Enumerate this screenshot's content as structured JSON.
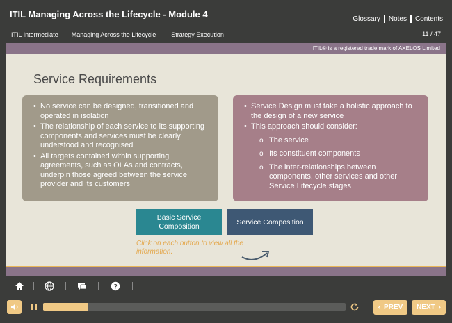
{
  "header": {
    "course_title": "ITIL Managing Across the Lifecycle - Module 4",
    "links": [
      "Glossary",
      "Notes",
      "Contents"
    ],
    "breadcrumb": [
      "ITIL Intermediate",
      "Managing Across the Lifecycle",
      "Strategy Execution"
    ],
    "page_count": "11 / 47"
  },
  "slide": {
    "trademark": "ITIL® is a registered trade mark of AXELOS Limited",
    "title": "Service Requirements",
    "left_box": [
      "No service can be designed, transitioned and operated in isolation",
      "The relationship of each service to its supporting components and services must be clearly understood and recognised",
      "All targets contained within supporting agreements, such as OLAs and contracts, underpin those agreed between the service provider and its customers"
    ],
    "right_box": {
      "bullets": [
        "Service Design must take a holistic approach to the design of a new service",
        "This approach should consider:"
      ],
      "sub_items": [
        "The service",
        "Its constituent components",
        "The inter-relationships between components, other services and other Service Lifecycle stages"
      ]
    },
    "buttons": {
      "basic": "Basic Service Composition",
      "composition": "Service Composition"
    },
    "hint": "Click on each button to view all the information."
  },
  "toolbar": {
    "icons": [
      "home-icon",
      "globe-icon",
      "chat-icon",
      "help-icon"
    ]
  },
  "controls": {
    "progress": 0.15,
    "prev": "PREV",
    "next": "NEXT"
  },
  "colors": {
    "background": "#3b3c3a",
    "slide_bg": "#e8e5d9",
    "accent_purple": "#8a7489",
    "accent_gold": "#f0c985",
    "left_box": "#a19a8a",
    "right_box": "#a67f89",
    "button_teal": "#2a8791",
    "button_navy": "#3e5874",
    "hint": "#e4a84d"
  }
}
